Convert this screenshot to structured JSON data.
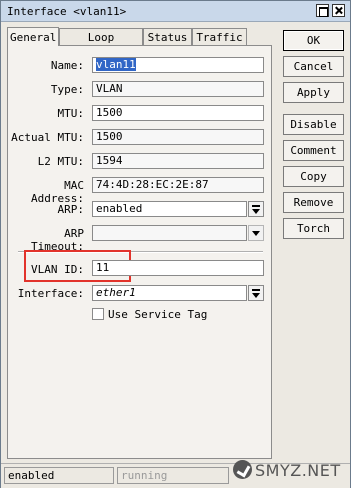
{
  "window": {
    "title": "Interface <vlan11>"
  },
  "tabs": [
    {
      "label": "General",
      "active": true
    },
    {
      "label": "Loop Protect",
      "active": false
    },
    {
      "label": "Status",
      "active": false
    },
    {
      "label": "Traffic",
      "active": false
    }
  ],
  "form": {
    "name": {
      "label": "Name:",
      "value": "vlan11"
    },
    "type": {
      "label": "Type:",
      "value": "VLAN"
    },
    "mtu": {
      "label": "MTU:",
      "value": "1500"
    },
    "actual_mtu": {
      "label": "Actual MTU:",
      "value": "1500"
    },
    "l2_mtu": {
      "label": "L2 MTU:",
      "value": "1594"
    },
    "mac_address": {
      "label": "MAC Address:",
      "value": "74:4D:28:EC:2E:87"
    },
    "arp": {
      "label": "ARP:",
      "value": "enabled"
    },
    "arp_timeout": {
      "label": "ARP Timeout:",
      "value": ""
    },
    "vlan_id": {
      "label": "VLAN ID:",
      "value": "11"
    },
    "interface": {
      "label": "Interface:",
      "value": "ether1"
    },
    "use_service_tag": {
      "label": "Use Service Tag",
      "checked": false
    }
  },
  "buttons": {
    "ok": "OK",
    "cancel": "Cancel",
    "apply": "Apply",
    "disable": "Disable",
    "comment": "Comment",
    "copy": "Copy",
    "remove": "Remove",
    "torch": "Torch"
  },
  "status": {
    "state": "enabled",
    "running": "running"
  },
  "watermark": {
    "text": "SMYZ.NET"
  },
  "colors": {
    "highlight_box": "#e2332b",
    "selection": "#3166c6",
    "titlebar": "#c9d8ea"
  }
}
